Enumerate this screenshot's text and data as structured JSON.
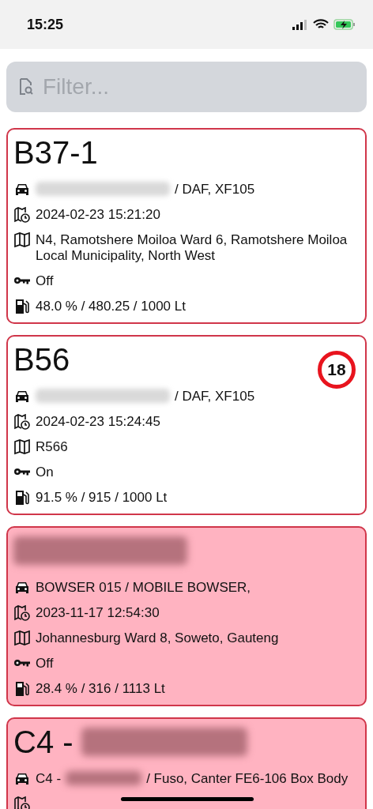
{
  "status_bar": {
    "time": "15:25",
    "charging": true
  },
  "filter": {
    "placeholder": "Filter..."
  },
  "cards": [
    {
      "alert": false,
      "title": "B37-1",
      "title_redacted": false,
      "rows": [
        {
          "kind": "vehicle",
          "redacted": true,
          "after": "/ DAF, XF105"
        },
        {
          "kind": "time",
          "text": "2024-02-23 15:21:20"
        },
        {
          "kind": "location",
          "text": "N4, Ramotshere Moiloa Ward 6, Ramotshere Moiloa Local Municipality, North West"
        },
        {
          "kind": "ignition",
          "text": "Off"
        },
        {
          "kind": "fuel",
          "text": "48.0 % / 480.25 / 1000 Lt"
        }
      ]
    },
    {
      "alert": false,
      "title": "B56",
      "title_redacted": false,
      "badge": "18",
      "rows": [
        {
          "kind": "vehicle",
          "redacted": true,
          "after": "/ DAF, XF105"
        },
        {
          "kind": "time",
          "text": "2024-02-23 15:24:45"
        },
        {
          "kind": "location",
          "text": "R566"
        },
        {
          "kind": "ignition",
          "text": "On"
        },
        {
          "kind": "fuel",
          "text": "91.5 % / 915 / 1000 Lt"
        }
      ]
    },
    {
      "alert": true,
      "title_redacted": true,
      "rows": [
        {
          "kind": "vehicle",
          "before": "BOWSER 015  / MOBILE BOWSER,",
          "redacted": false
        },
        {
          "kind": "time",
          "text": "2023-11-17 12:54:30"
        },
        {
          "kind": "location",
          "text": "Johannesburg Ward 8, Soweto, Gauteng"
        },
        {
          "kind": "ignition",
          "text": "Off"
        },
        {
          "kind": "fuel",
          "text": "28.4 % / 316 / 1113 Lt"
        }
      ]
    },
    {
      "alert": true,
      "title": "C4 -",
      "title_redacted": true,
      "rows": [
        {
          "kind": "vehicle",
          "before": "C4 -",
          "redacted": true,
          "after": "/ Fuso, Canter FE6-106 Box Body"
        },
        {
          "kind": "time"
        }
      ]
    }
  ]
}
